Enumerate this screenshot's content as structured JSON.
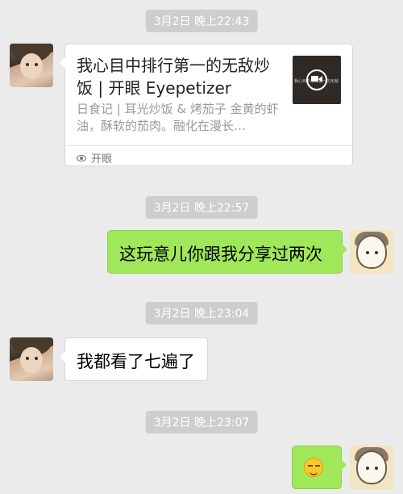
{
  "timestamps": [
    "3月2日 晚上22:43",
    "3月2日 晚上22:57",
    "3月2日 晚上23:04",
    "3月2日 晚上23:07"
  ],
  "card": {
    "title": "我心目中排行第一的无敌炒饭 | 开眼 Eyepetizer",
    "description": "日食记 | 耳光炒饭 & 烤茄子 金黄的虾油，酥软的茄肉。融化在漫长…",
    "thumb_caption": "我心目中排行第一的无敌",
    "source": "开眼"
  },
  "messages": {
    "msg2": "这玩意儿你跟我分享过两次",
    "msg3": "我都看了七遍了",
    "msg4_emoji": "smirk-emoji"
  },
  "colors": {
    "background": "#ebebeb",
    "sent_bubble": "#a0e759",
    "received_bubble": "#ffffff",
    "timestamp_bg": "#cecece"
  }
}
